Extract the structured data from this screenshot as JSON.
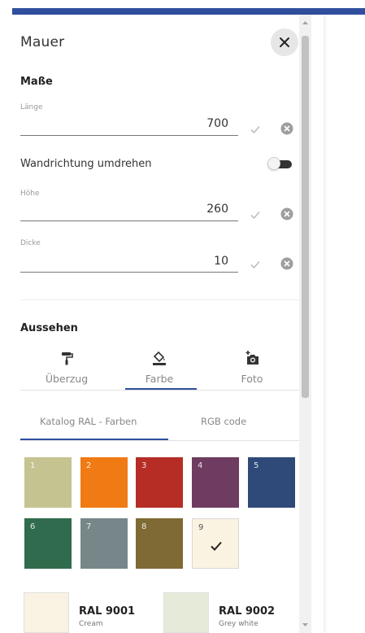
{
  "panel": {
    "title": "Mauer",
    "close_icon": "close-icon"
  },
  "dimensions": {
    "heading": "Maße",
    "length": {
      "label": "Länge",
      "value": "700"
    },
    "flip_direction": {
      "label": "Wandrichtung umdrehen",
      "enabled": false
    },
    "height": {
      "label": "Höhe",
      "value": "260"
    },
    "thickness": {
      "label": "Dicke",
      "value": "10"
    }
  },
  "appearance": {
    "heading": "Aussehen",
    "tabs": [
      {
        "label": "Überzug",
        "icon": "paint-roller-icon",
        "active": false
      },
      {
        "label": "Farbe",
        "icon": "paint-bucket-icon",
        "active": true
      },
      {
        "label": "Foto",
        "icon": "add-photo-icon",
        "active": false
      }
    ],
    "color_source_tabs": [
      {
        "label": "Katalog RAL - Farben",
        "active": true
      },
      {
        "label": "RGB code",
        "active": false
      }
    ],
    "swatches": [
      {
        "num": "1",
        "color": "#c5c390"
      },
      {
        "num": "2",
        "color": "#f07a14"
      },
      {
        "num": "3",
        "color": "#b52d24"
      },
      {
        "num": "4",
        "color": "#6d3c60"
      },
      {
        "num": "5",
        "color": "#2f4a78"
      },
      {
        "num": "6",
        "color": "#2f6b4c"
      },
      {
        "num": "7",
        "color": "#778689"
      },
      {
        "num": "8",
        "color": "#7f6a35"
      },
      {
        "num": "9",
        "color": "#fbf3e2",
        "selected": true
      }
    ],
    "ral_colors": [
      {
        "code": "RAL 9001",
        "name": "Cream",
        "color": "#faf2e2"
      },
      {
        "code": "RAL 9002",
        "name": "Grey white",
        "color": "#e6ead8"
      }
    ]
  },
  "colors": {
    "accent": "#2f4f9e",
    "toggle_track": "#333333"
  }
}
